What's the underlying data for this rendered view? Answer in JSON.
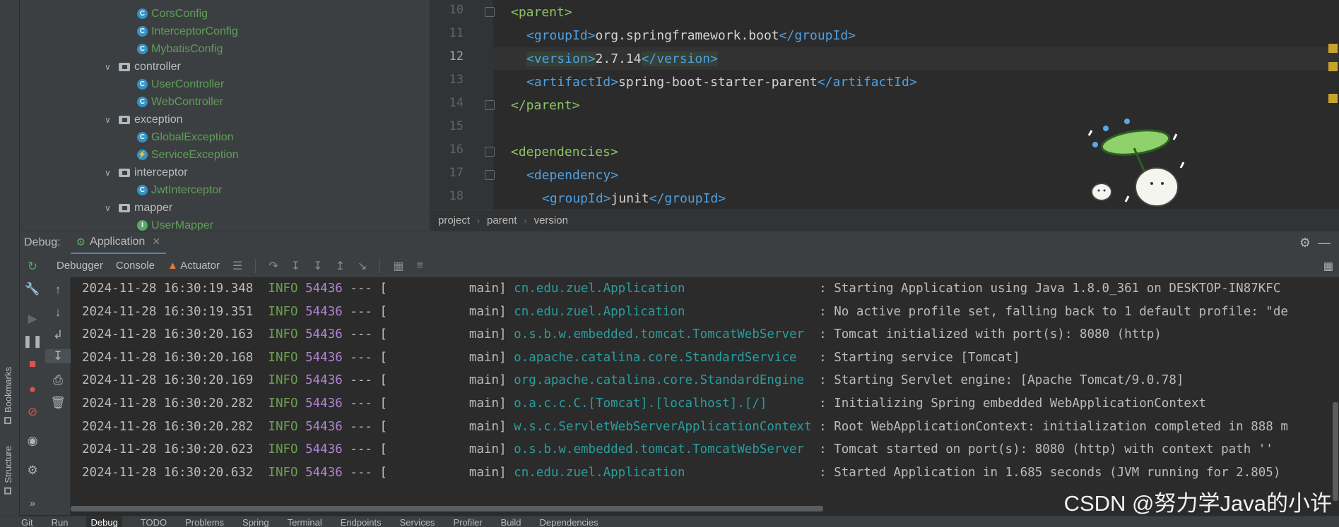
{
  "left_strip": {
    "bookmarks": "Bookmarks",
    "structure": "Structure"
  },
  "project_tree": [
    {
      "kind": "class",
      "label": "CorsConfig"
    },
    {
      "kind": "class",
      "label": "InterceptorConfig"
    },
    {
      "kind": "class",
      "label": "MybatisConfig"
    },
    {
      "kind": "folder",
      "label": "controller"
    },
    {
      "kind": "class",
      "label": "UserController"
    },
    {
      "kind": "class",
      "label": "WebController"
    },
    {
      "kind": "folder",
      "label": "exception"
    },
    {
      "kind": "class",
      "label": "GlobalException"
    },
    {
      "kind": "class",
      "label": "ServiceException"
    },
    {
      "kind": "folder",
      "label": "interceptor"
    },
    {
      "kind": "class",
      "label": "JwtInterceptor"
    },
    {
      "kind": "folder",
      "label": "mapper"
    },
    {
      "kind": "interface",
      "label": "UserMapper"
    }
  ],
  "editor": {
    "line_numbers": [
      "10",
      "11",
      "12",
      "13",
      "14",
      "15",
      "16",
      "17",
      "18"
    ],
    "current_line": "12",
    "lines": {
      "l10": {
        "open": "<parent>"
      },
      "l11": {
        "open": "<groupId>",
        "text": "org.springframework.boot",
        "close": "</groupId>"
      },
      "l12": {
        "open": "<version>",
        "text": "2.7.14",
        "close": "</version>"
      },
      "l13": {
        "open": "<artifactId>",
        "text": "spring-boot-starter-parent",
        "close": "</artifactId>"
      },
      "l14": {
        "close": "</parent>"
      },
      "l16": {
        "open": "<dependencies>"
      },
      "l17": {
        "open": "<dependency>"
      },
      "l18": {
        "open": "<groupId>",
        "text": "junit",
        "close": "</groupId>"
      }
    },
    "breadcrumb": [
      "project",
      "parent",
      "version"
    ]
  },
  "debug": {
    "title": "Debug:",
    "session_tab": "Application",
    "tabs": [
      "Debugger",
      "Console",
      "Actuator"
    ]
  },
  "console_logs": [
    {
      "ts": "2024-11-28 16:30:19.348",
      "level": "INFO",
      "pid": "54436",
      "sep": "--- [",
      "thread": "          main]",
      "cls": "cn.edu.zuel.Application                 ",
      "msg": ": Starting Application using Java 1.8.0_361 on DESKTOP-IN87KFC"
    },
    {
      "ts": "2024-11-28 16:30:19.351",
      "level": "INFO",
      "pid": "54436",
      "sep": "--- [",
      "thread": "          main]",
      "cls": "cn.edu.zuel.Application                 ",
      "msg": ": No active profile set, falling back to 1 default profile: \"de"
    },
    {
      "ts": "2024-11-28 16:30:20.163",
      "level": "INFO",
      "pid": "54436",
      "sep": "--- [",
      "thread": "          main]",
      "cls": "o.s.b.w.embedded.tomcat.TomcatWebServer ",
      "msg": ": Tomcat initialized with port(s): 8080 (http)"
    },
    {
      "ts": "2024-11-28 16:30:20.168",
      "level": "INFO",
      "pid": "54436",
      "sep": "--- [",
      "thread": "          main]",
      "cls": "o.apache.catalina.core.StandardService  ",
      "msg": ": Starting service [Tomcat]"
    },
    {
      "ts": "2024-11-28 16:30:20.169",
      "level": "INFO",
      "pid": "54436",
      "sep": "--- [",
      "thread": "          main]",
      "cls": "org.apache.catalina.core.StandardEngine ",
      "msg": ": Starting Servlet engine: [Apache Tomcat/9.0.78]"
    },
    {
      "ts": "2024-11-28 16:30:20.282",
      "level": "INFO",
      "pid": "54436",
      "sep": "--- [",
      "thread": "          main]",
      "cls": "o.a.c.c.C.[Tomcat].[localhost].[/]      ",
      "msg": ": Initializing Spring embedded WebApplicationContext"
    },
    {
      "ts": "2024-11-28 16:30:20.282",
      "level": "INFO",
      "pid": "54436",
      "sep": "--- [",
      "thread": "          main]",
      "cls": "w.s.c.ServletWebServerApplicationContext",
      "msg": ": Root WebApplicationContext: initialization completed in 888 m"
    },
    {
      "ts": "2024-11-28 16:30:20.623",
      "level": "INFO",
      "pid": "54436",
      "sep": "--- [",
      "thread": "          main]",
      "cls": "o.s.b.w.embedded.tomcat.TomcatWebServer ",
      "msg": ": Tomcat started on port(s): 8080 (http) with context path ''"
    },
    {
      "ts": "2024-11-28 16:30:20.632",
      "level": "INFO",
      "pid": "54436",
      "sep": "--- [",
      "thread": "          main]",
      "cls": "cn.edu.zuel.Application                 ",
      "msg": ": Started Application in 1.685 seconds (JVM running for 2.805)"
    }
  ],
  "watermark": "CSDN @努力学Java的小许",
  "bottom_tabs": [
    "Git",
    "Run",
    "Debug",
    "TODO",
    "Problems",
    "Spring",
    "Terminal",
    "Endpoints",
    "Services",
    "Profiler",
    "Build",
    "Dependencies"
  ]
}
